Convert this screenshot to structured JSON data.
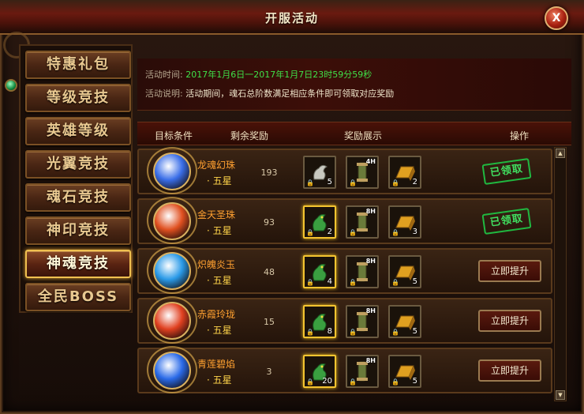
{
  "window": {
    "title": "开服活动",
    "close_label": "X"
  },
  "sidebar": {
    "items": [
      {
        "label": "特惠礼包",
        "active": false
      },
      {
        "label": "等级竞技",
        "active": false
      },
      {
        "label": "英雄等级",
        "active": false
      },
      {
        "label": "光翼竞技",
        "active": false
      },
      {
        "label": "魂石竞技",
        "active": false
      },
      {
        "label": "神印竞技",
        "active": false
      },
      {
        "label": "神魂竞技",
        "active": true
      },
      {
        "label": "全民BOSS",
        "active": false
      }
    ]
  },
  "info": {
    "time_label": "活动时间:",
    "time_value": "2017年1月6日一2017年1月7日23时59分59秒",
    "desc_label": "活动说明:",
    "desc_value": "活动期间，魂石总阶数满足相应条件即可领取对应奖励"
  },
  "headers": {
    "target": "目标条件",
    "remaining": "剩余奖励",
    "rewards": "奖励展示",
    "action": "操作"
  },
  "rows": [
    {
      "name": "龙魂幻珠",
      "star": "· 五星",
      "remaining": "193",
      "rewards": [
        {
          "count": "5",
          "hours": "",
          "icon": "dragon-statue-icon",
          "highlight": false
        },
        {
          "count": "",
          "hours": "4H",
          "icon": "scroll-icon",
          "highlight": false
        },
        {
          "count": "2",
          "hours": "",
          "icon": "gold-bar-icon",
          "highlight": false
        }
      ],
      "status": "claimed",
      "status_label": "已领取"
    },
    {
      "name": "金天圣珠",
      "star": "· 五星",
      "remaining": "93",
      "rewards": [
        {
          "count": "2",
          "hours": "",
          "icon": "green-dragon-icon",
          "highlight": true
        },
        {
          "count": "",
          "hours": "8H",
          "icon": "scroll-icon",
          "highlight": false
        },
        {
          "count": "3",
          "hours": "",
          "icon": "gold-bar-icon",
          "highlight": false
        }
      ],
      "status": "claimed",
      "status_label": "已领取"
    },
    {
      "name": "炽魄炎玉",
      "star": "· 五星",
      "remaining": "48",
      "rewards": [
        {
          "count": "4",
          "hours": "",
          "icon": "green-dragon-icon",
          "highlight": true
        },
        {
          "count": "",
          "hours": "8H",
          "icon": "scroll-icon",
          "highlight": false
        },
        {
          "count": "5",
          "hours": "",
          "icon": "gold-bar-icon",
          "highlight": false
        }
      ],
      "status": "button",
      "status_label": "立即提升"
    },
    {
      "name": "赤霞玲珑",
      "star": "· 五星",
      "remaining": "15",
      "rewards": [
        {
          "count": "8",
          "hours": "",
          "icon": "green-dragon-icon",
          "highlight": true
        },
        {
          "count": "",
          "hours": "8H",
          "icon": "scroll-icon",
          "highlight": false
        },
        {
          "count": "5",
          "hours": "",
          "icon": "gold-bar-icon",
          "highlight": false
        }
      ],
      "status": "button",
      "status_label": "立即提升"
    },
    {
      "name": "青莲碧焰",
      "star": "· 五星",
      "remaining": "3",
      "rewards": [
        {
          "count": "20",
          "hours": "",
          "icon": "green-dragon-icon",
          "highlight": true
        },
        {
          "count": "",
          "hours": "8H",
          "icon": "scroll-icon",
          "highlight": false
        },
        {
          "count": "5",
          "hours": "",
          "icon": "gold-bar-icon",
          "highlight": false
        }
      ],
      "status": "button",
      "status_label": "立即提升"
    }
  ],
  "orb_colors": [
    "#3a6ee8",
    "#e05020",
    "#2a9ae8",
    "#e04020",
    "#2a6ae8"
  ]
}
